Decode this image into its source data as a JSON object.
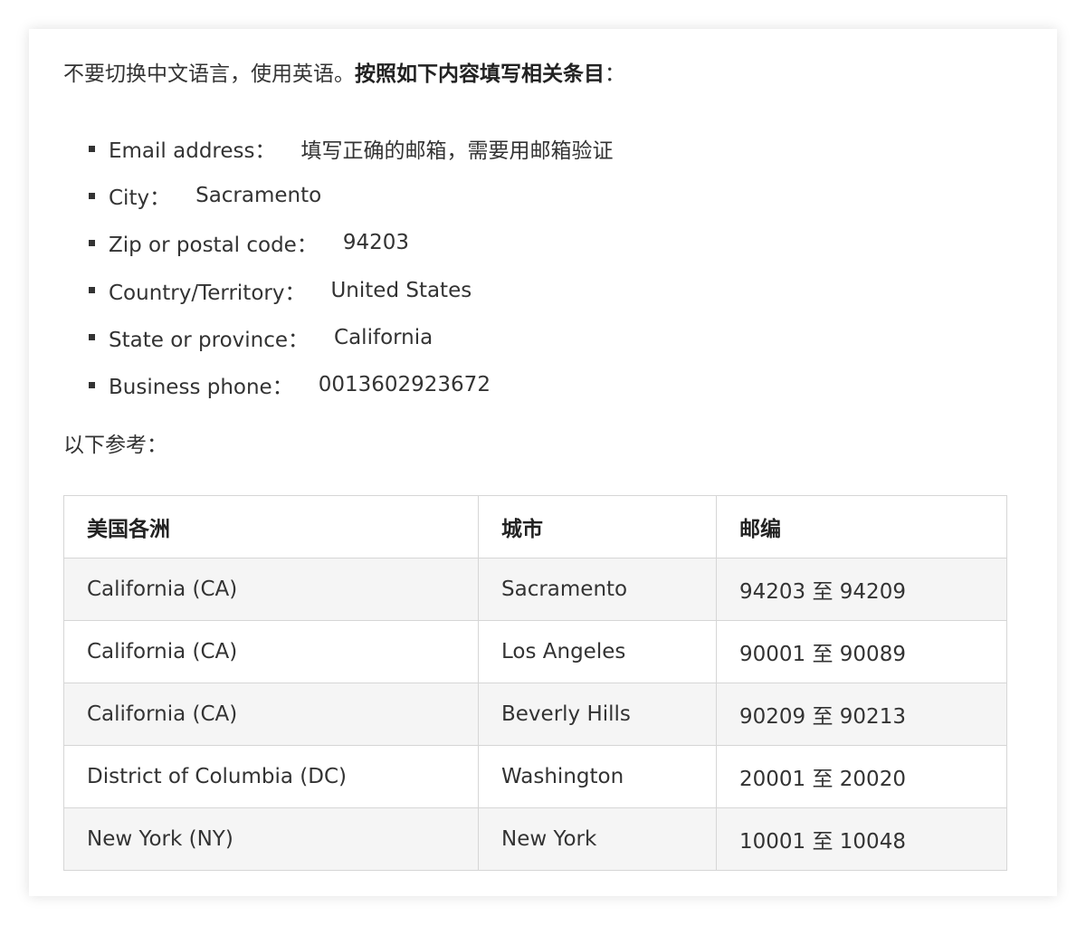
{
  "intro": {
    "text": "不要切换中文语言，使用英语。",
    "bold": "按照如下内容填写相关条目",
    "colon": "："
  },
  "fields": [
    {
      "label": "Email address：",
      "value": "填写正确的邮箱，需要用邮箱验证"
    },
    {
      "label": "City：",
      "value": "Sacramento"
    },
    {
      "label": "Zip or postal code：",
      "value": "94203"
    },
    {
      "label": "Country/Territory：",
      "value": "United States"
    },
    {
      "label": "State or province：",
      "value": "California"
    },
    {
      "label": "Business phone：",
      "value": "0013602923672"
    }
  ],
  "reference_label": "以下参考：",
  "table": {
    "headers": [
      "美国各洲",
      "城市",
      "邮编"
    ],
    "rows": [
      [
        "California (CA)",
        "Sacramento",
        "94203 至 94209"
      ],
      [
        "California (CA)",
        "Los Angeles",
        "90001 至 90089"
      ],
      [
        "California (CA)",
        "Beverly Hills",
        "90209 至 90213"
      ],
      [
        "District of Columbia (DC)",
        "Washington",
        "20001 至 20020"
      ],
      [
        "New York (NY)",
        "New York",
        "10001 至 10048"
      ]
    ]
  }
}
